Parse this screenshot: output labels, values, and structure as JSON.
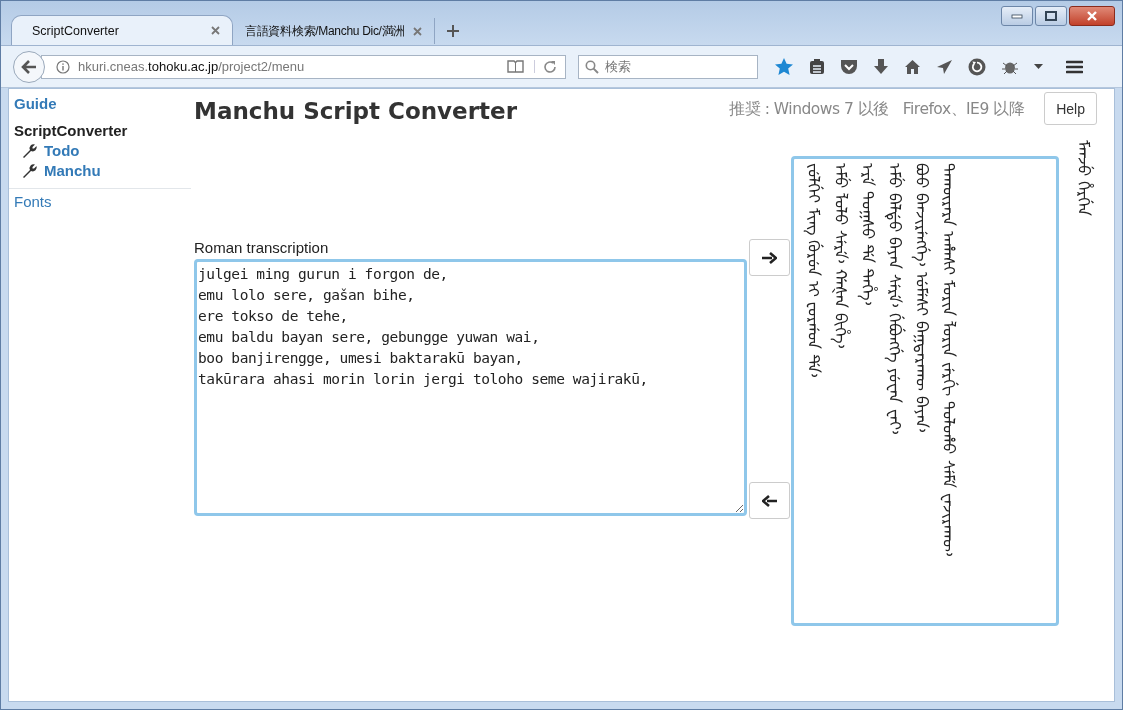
{
  "tabs": [
    {
      "label": "ScriptConverter",
      "selected": true
    },
    {
      "label": "言語資料検索/Manchu Dic/満洲",
      "selected": false
    }
  ],
  "address_bar": {
    "host_prefix": "hkuri.cneas.",
    "domain": "tohoku.ac.jp",
    "path": "/project2/menu"
  },
  "search": {
    "placeholder": "検索"
  },
  "sidebar": {
    "items": [
      {
        "label": "Guide",
        "kind": "link"
      },
      {
        "label": "ScriptConverter",
        "kind": "heading"
      },
      {
        "label": "Todo",
        "kind": "tool"
      },
      {
        "label": "Manchu",
        "kind": "tool"
      },
      {
        "label": "Fonts",
        "kind": "section"
      }
    ]
  },
  "page": {
    "title": "Manchu Script Converter",
    "requirements": [
      "推奨 : Windows 7 以後",
      "Firefox、IE9 以降"
    ],
    "help_button": "Help"
  },
  "converter": {
    "input_label": "Roman transcription",
    "input_lines": [
      "julgei ming gurun i forgon de,",
      "emu lolo sere, gašan bihe,",
      "ere tokso de tehe,",
      "emu baldu bayan sere, gebungge yuwan wai,",
      "boo banjirengge, umesi baktarakū bayan,",
      "takūrara ahasi morin lorin jergi toloho seme wajirakū,"
    ],
    "output_label": "ᠮᠠᠨᠵᡠ ᡥᡝᡵᡤᡝᠨ",
    "output_lines": [
      "ᠵᡠᠯᡤᡝᡳ ᠮᡳᠩ ᡤᡠᡵᡠᠨ ᡳ ᡶᠣᡵᡤᠣᠨ ᡩᡝ᠈",
      "ᡝᠮᡠ ᠯᠣᠯᠣ ᠰᡝᡵᡝ᠈ ᡤᠠᡧᠠᠨ ᠪᡳᡥᡝ᠈",
      "ᡝᡵᡝ ᡨᠣᡴᠰᠣ ᡩᡝ ᡨᡝᡥᡝ᠈",
      "ᡝᠮᡠ ᠪᠠᠯᡩᡠ ᠪᠠᠶᠠᠨ ᠰᡝᡵᡝ᠈ ᡤᡝᠪᡠᠩᡤᡝ ᠶᡠᠸᠠᠨ ᠸᠠᡳ᠈",
      "ᠪᠣᠣ ᠪᠠᠨᠵᡳᡵᡝᠩᡤᡝ᠈ ᡠᠮᡝᠰᡳ ᠪᠠᡴᡨᠠᡵᠠᡴᡡ ᠪᠠᠶᠠᠨ᠈",
      "ᡨᠠᡴᡡᡵᠠᡵᠠ ᠠᡥᠠᠰᡳ ᠮᠣᡵᡳᠨ ᠯᠣᡵᡳᠨ ᠵᡝᡵᡤᡳ ᡨᠣᠯᠣᡥᠣ ᠰᡝᠮᡝ ᠸᠠᠵᡳᡵᠠᡴᡡ᠈"
    ]
  }
}
